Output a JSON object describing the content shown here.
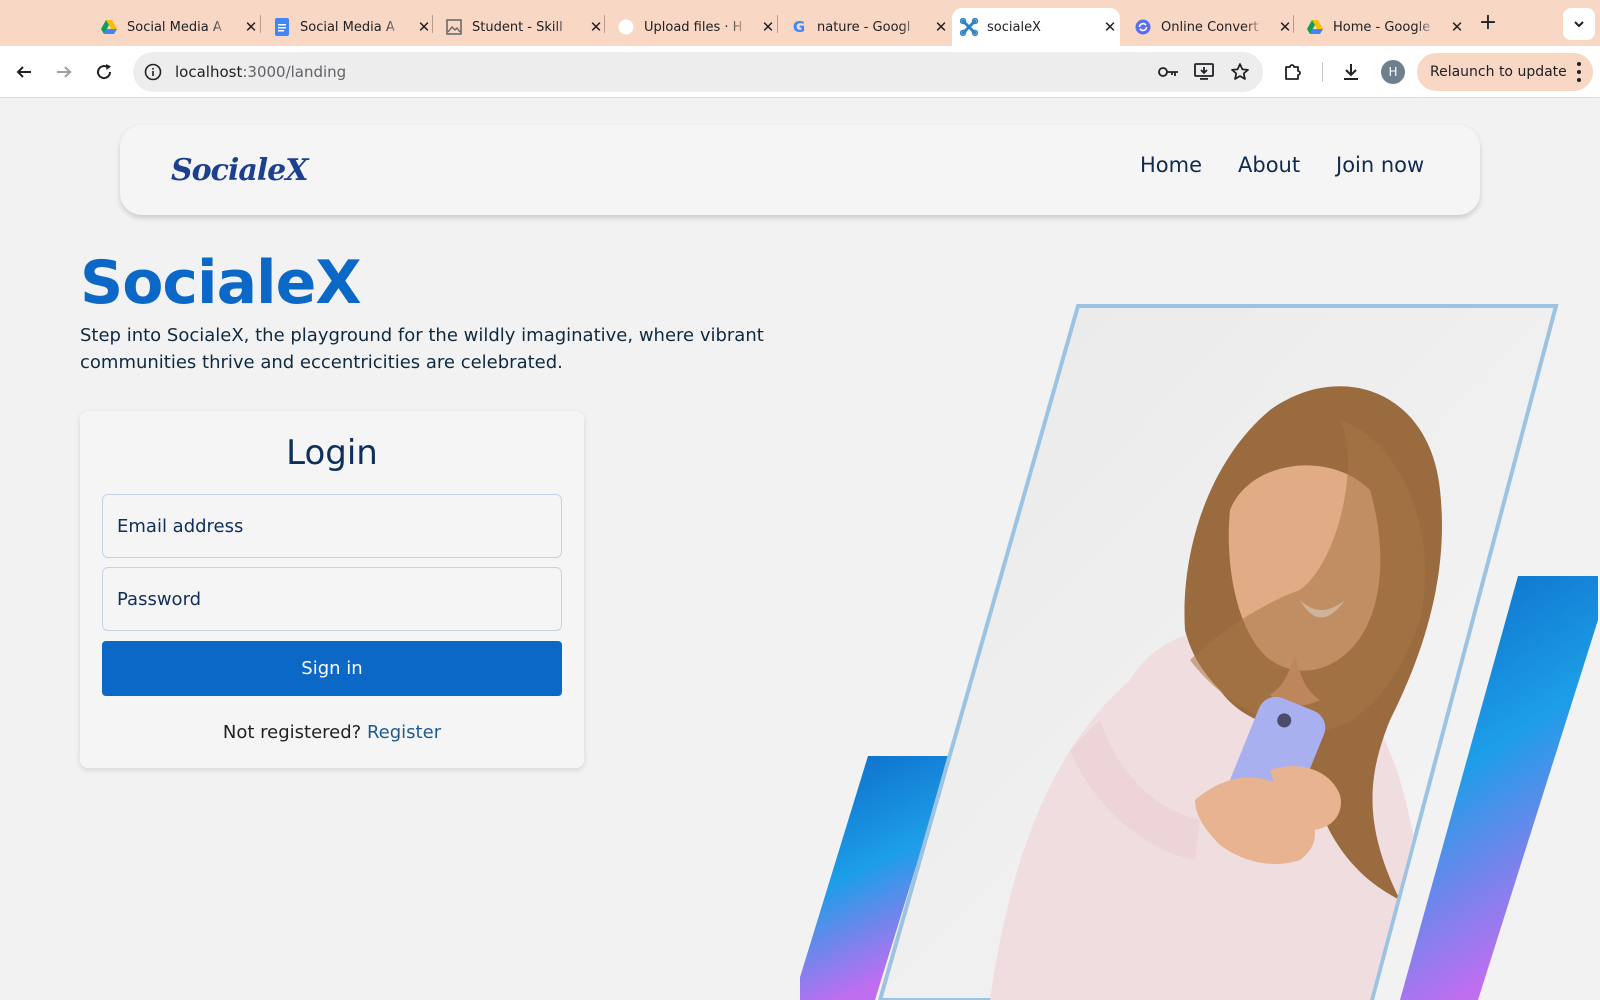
{
  "browser": {
    "tabs": [
      {
        "title": "Social Media A",
        "icon": "google-drive-icon"
      },
      {
        "title": "Social Media A",
        "icon": "google-docs-icon"
      },
      {
        "title": "Student - Skill",
        "icon": "image-icon"
      },
      {
        "title": "Upload files · H",
        "icon": "github-icon"
      },
      {
        "title": "nature - Googl",
        "icon": "google-icon"
      },
      {
        "title": "socialeX",
        "icon": "socialex-icon",
        "active": true
      },
      {
        "title": "Online Convert",
        "icon": "converter-icon"
      },
      {
        "title": "Home - Google",
        "icon": "google-drive-icon"
      }
    ],
    "new_tab": "+",
    "close_glyph": "✕",
    "url_host": "localhost",
    "url_path": ":3000/landing",
    "profile_initial": "H",
    "relaunch_label": "Relaunch to update"
  },
  "nav": {
    "logo_text": "SocialeX",
    "links": [
      "Home",
      "About",
      "Join now"
    ]
  },
  "hero": {
    "title": "SocialeX",
    "description": "Step into SocialeX, the playground for the wildly imaginative, where vibrant communities thrive and eccentricities are celebrated."
  },
  "login": {
    "title": "Login",
    "email_placeholder": "Email address",
    "password_placeholder": "Password",
    "submit_label": "Sign in",
    "register_prompt": "Not registered?",
    "register_link": "Register"
  },
  "colors": {
    "brand": "#0b68c7",
    "tabbar": "#f9d7c5",
    "page_bg": "#f2f2f2",
    "gradient": [
      "#0b68c7",
      "#1d9ee8",
      "#c06ef0"
    ]
  }
}
